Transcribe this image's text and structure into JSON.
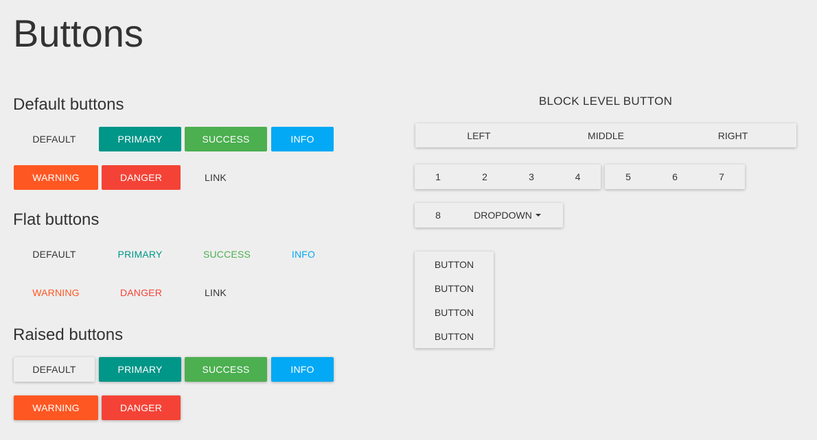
{
  "page_title": "Buttons",
  "colors": {
    "primary": "#009688",
    "success": "#4caf50",
    "info": "#03a9f4",
    "warning": "#ff5722",
    "danger": "#f44336",
    "background": "#eeeeee",
    "text": "#333333"
  },
  "default_buttons": {
    "title": "Default buttons",
    "default": "DEFAULT",
    "primary": "PRIMARY",
    "success": "SUCCESS",
    "info": "INFO",
    "warning": "WARNING",
    "danger": "DANGER",
    "link": "LINK"
  },
  "flat_buttons": {
    "title": "Flat buttons",
    "default": "DEFAULT",
    "primary": "PRIMARY",
    "success": "SUCCESS",
    "info": "INFO",
    "warning": "WARNING",
    "danger": "DANGER",
    "link": "LINK"
  },
  "raised_buttons": {
    "title": "Raised buttons",
    "default": "DEFAULT",
    "primary": "PRIMARY",
    "success": "SUCCESS",
    "info": "INFO",
    "warning": "WARNING",
    "danger": "DANGER"
  },
  "block_level": {
    "title": "BLOCK LEVEL BUTTON",
    "left": "LEFT",
    "middle": "MIDDLE",
    "right": "RIGHT"
  },
  "number_group_a": [
    "1",
    "2",
    "3",
    "4"
  ],
  "number_group_b": [
    "5",
    "6",
    "7"
  ],
  "dropdown_group": {
    "number": "8",
    "dropdown": "DROPDOWN",
    "caret_icon": "caret-down-icon"
  },
  "vertical_group": [
    "BUTTON",
    "BUTTON",
    "BUTTON",
    "BUTTON"
  ]
}
